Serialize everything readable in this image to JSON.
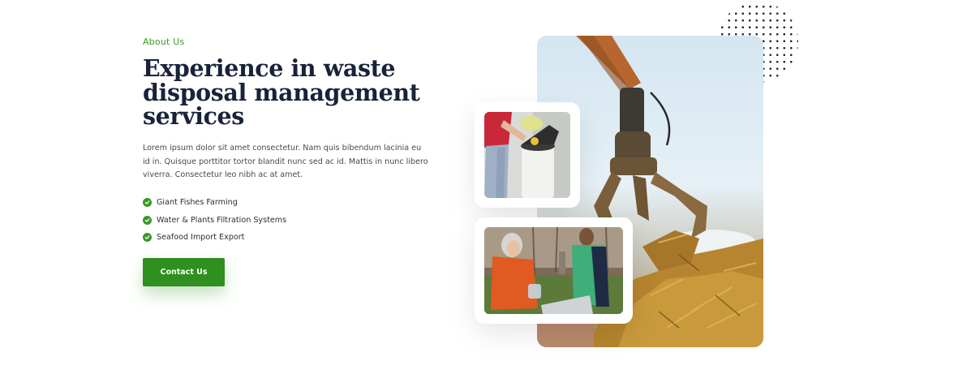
{
  "about": {
    "eyebrow": "About Us",
    "headline_lines": [
      "Experience in waste",
      "disposal management",
      "services"
    ],
    "body_lines": [
      "Lorem ipsum dolor sit amet consectetur. Nam quis bibendum lacinia eu",
      "id in. Quisque porttitor tortor blandit nunc sed ac id. Mattis in nunc libero",
      "viverra. Consectetur leo nibh ac at amet."
    ],
    "features": [
      {
        "label": "Giant Fishes Farming",
        "icon": "check-circle-icon"
      },
      {
        "label": "Water & Plants Filtration Systems",
        "icon": "check-circle-icon"
      },
      {
        "label": "Seafood Import Export",
        "icon": "check-circle-icon"
      }
    ],
    "cta_label": "Contact Us"
  },
  "media": {
    "main_photo": "scrap-metal-grapple-photo",
    "card_photos": [
      "recycling-bin-photo",
      "volunteers-collecting-bottles-photo"
    ],
    "decoration": "dot-pattern-circle"
  },
  "colors": {
    "accent": "#3a9a26",
    "cta_background": "#2f8f1f",
    "heading": "#18233b",
    "body": "#444a52"
  }
}
